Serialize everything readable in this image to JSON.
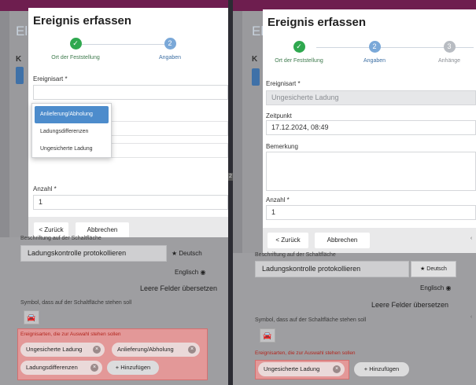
{
  "background": {
    "app_title_partial": "Ele",
    "k_label": "K"
  },
  "colors": {
    "topbar": "#6e1e4f",
    "primary": "#4d8ccc",
    "success": "#2fa84f",
    "highlight": "#ee9696"
  },
  "modal": {
    "title": "Ereignis erfassen",
    "steps": [
      {
        "label": "Ort der Feststellung",
        "state": "done",
        "icon": "check-icon"
      },
      {
        "label": "Angaben",
        "state": "active",
        "number": "2"
      },
      {
        "label": "Anhänge",
        "state": "todo",
        "number": "3"
      }
    ],
    "back_label": "< Zurück",
    "cancel_label": "Abbrechen"
  },
  "left": {
    "ereignisart_label": "Ereignisart *",
    "dropdown_options": [
      "Anlieferung/Abholung",
      "Ladungsdifferenzen",
      "Ungesicherte Ladung"
    ],
    "anzahl_label": "Anzahl *",
    "anzahl_value": "1"
  },
  "right": {
    "ereignisart_label": "Ereignisart *",
    "ereignisart_value": "Ungesicherte Ladung",
    "zeitpunkt_label": "Zeitpunkt",
    "zeitpunkt_value": "17.12.2024, 08:49",
    "bemerkung_label": "Bemerkung",
    "anzahl_label": "Anzahl *",
    "anzahl_value": "1"
  },
  "config": {
    "beschriftung_label": "Beschriftung auf der Schaltfläche",
    "beschriftung_value": "Ladungskontrolle protokollieren",
    "deutsch_label": "Deutsch",
    "englisch_label": "Englisch",
    "uebersetzen_label": "Leere Felder übersetzen",
    "symbol_label": "Symbol, dass auf der Schaltfläche stehen soll",
    "ereignisarten_label": "Ereignisarten, die zur Auswahl stehen sollen",
    "hinzufuegen_label": "+ Hinzufügen",
    "left_tags": [
      "Ungesicherte Ladung",
      "Anlieferung/Abholung",
      "Ladungsdifferenzen"
    ],
    "right_tags": [
      "Ungesicherte Ladung"
    ]
  },
  "divider_badge": "2"
}
